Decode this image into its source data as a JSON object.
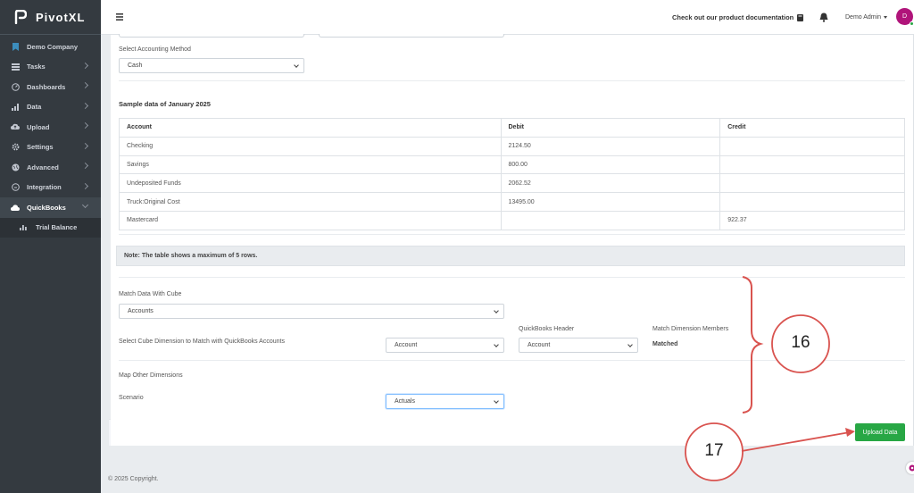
{
  "brand": {
    "name": "PivotXL"
  },
  "sidebar": {
    "company": "Demo Company",
    "items": [
      {
        "label": "Tasks",
        "icon": "tasks-icon"
      },
      {
        "label": "Dashboards",
        "icon": "dashboard-icon"
      },
      {
        "label": "Data",
        "icon": "bar-chart-icon"
      },
      {
        "label": "Upload",
        "icon": "cloud-upload-icon"
      },
      {
        "label": "Settings",
        "icon": "gear-icon"
      },
      {
        "label": "Advanced",
        "icon": "globe-icon"
      },
      {
        "label": "Integration",
        "icon": "plug-icon"
      },
      {
        "label": "QuickBooks",
        "icon": "cloud-icon"
      }
    ],
    "sub_item": "Trial Balance"
  },
  "topbar": {
    "doc_link": "Check out our product documentation",
    "user": "Demo Admin",
    "avatar_initial": "D"
  },
  "form": {
    "accounting_method_label": "Select Accounting Method",
    "accounting_method_value": "Cash",
    "sample_title": "Sample data of January 2025",
    "table": {
      "headers": [
        "Account",
        "Debit",
        "Credit"
      ],
      "rows": [
        [
          "Checking",
          "2124.50",
          ""
        ],
        [
          "Savings",
          "800.00",
          ""
        ],
        [
          "Undeposited Funds",
          "2062.52",
          ""
        ],
        [
          "Truck:Original Cost",
          "13495.00",
          ""
        ],
        [
          "Mastercard",
          "",
          "922.37"
        ]
      ]
    },
    "note": "Note: The table shows a maximum of 5 rows.",
    "match_cube_label": "Match Data With Cube",
    "match_cube_value": "Accounts",
    "qb_header_label": "QuickBooks Header",
    "match_dim_label": "Match Dimension Members",
    "cube_dim_label": "Select Cube Dimension to Match with QuickBooks Accounts",
    "cube_dim_value": "Account",
    "qb_header_value": "Account",
    "matched_text": "Matched",
    "map_other_label": "Map Other Dimensions",
    "scenario_label": "Scenario",
    "scenario_value": "Actuals",
    "upload_button": "Upload Data"
  },
  "footer": {
    "copyright": "© 2025 Copyright."
  },
  "annotations": {
    "callout_16": "16",
    "callout_17": "17",
    "color": "#d9534f"
  }
}
